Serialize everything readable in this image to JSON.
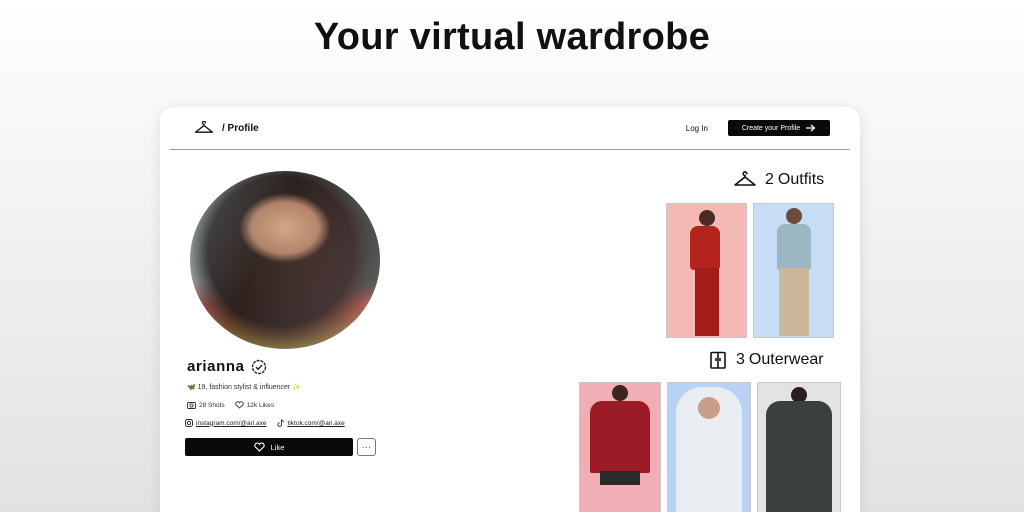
{
  "hero": {
    "title": "Your virtual wardrobe"
  },
  "nav": {
    "breadcrumb": "/ Profile",
    "login_label": "Log In",
    "create_label": "Create your Profile"
  },
  "profile": {
    "username": "arianna",
    "bio": "🦋 19, fashion stylist & influencer ✨",
    "shots": "28 Shots",
    "likes": "12k Likes",
    "instagram": "instagram.com/@ari.axe",
    "tiktok": "tiktok.com/@ari.axe",
    "like_label": "Like",
    "more_label": "···"
  },
  "sections": {
    "outfits": {
      "count": "2",
      "label": "Outfits"
    },
    "outerwear": {
      "count": "3",
      "label": "Outerwear"
    }
  },
  "colors": {
    "accent": "#0a0a0a",
    "outfit1_bg": "#f5b9b4",
    "outfit2_bg": "#c7dcf5",
    "outer1_bg": "#f0aeb4",
    "outer2_bg": "#b7d2f3",
    "outer3_bg": "#e3e3e3"
  },
  "icons": {
    "brand": "hanger-icon",
    "create": "arrow-right-icon",
    "verified": "verified-badge-icon",
    "shots": "camera-icon",
    "likes": "heart-icon",
    "instagram": "instagram-icon",
    "tiktok": "tiktok-icon",
    "outfits": "hanger-icon",
    "outerwear": "wardrobe-icon"
  }
}
